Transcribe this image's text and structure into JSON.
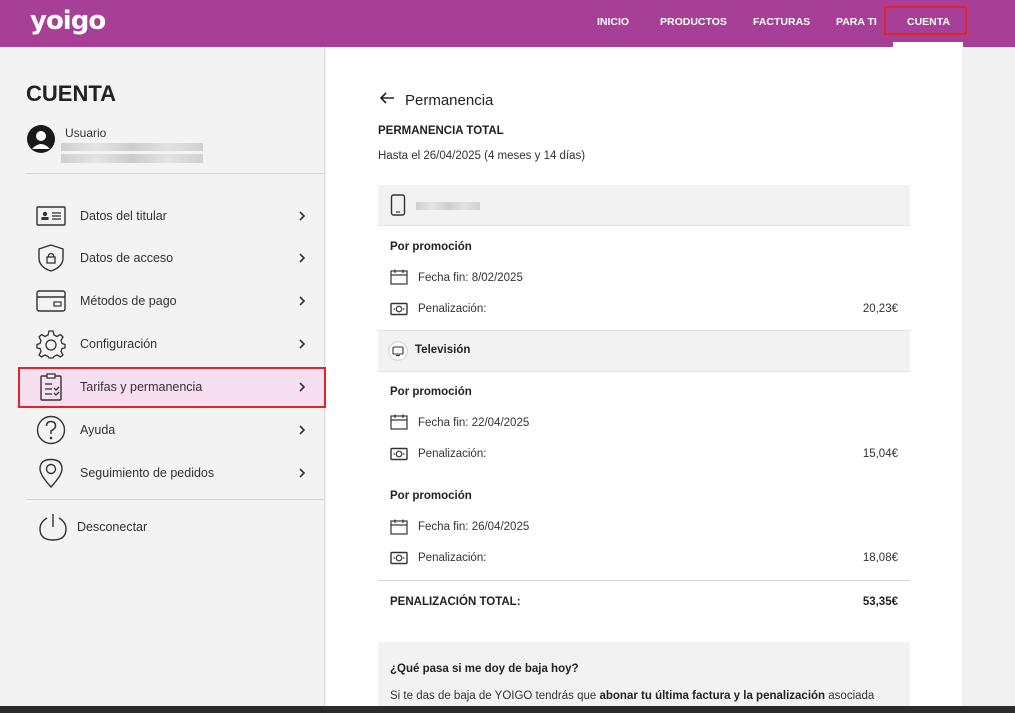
{
  "header": {
    "logo": "yoigo",
    "nav": [
      "INICIO",
      "PRODUCTOS",
      "FACTURAS",
      "PARA TI",
      "CUENTA"
    ],
    "active": "CUENTA"
  },
  "sidebar": {
    "title": "CUENTA",
    "user_label": "Usuario",
    "items": [
      {
        "label": "Datos del titular",
        "icon": "id-card-icon"
      },
      {
        "label": "Datos de acceso",
        "icon": "shield-lock-icon"
      },
      {
        "label": "Métodos de pago",
        "icon": "credit-card-icon"
      },
      {
        "label": "Configuración",
        "icon": "gear-icon"
      },
      {
        "label": "Tarifas y permanencia",
        "icon": "clipboard-icon"
      },
      {
        "label": "Ayuda",
        "icon": "help-icon"
      },
      {
        "label": "Seguimiento de pedidos",
        "icon": "location-pin-icon"
      }
    ],
    "logout": "Desconectar"
  },
  "main": {
    "title": "Permanencia",
    "total_heading": "PERMANENCIA TOTAL",
    "total_until": "Hasta el 26/04/2025 (4 meses y 14 días)",
    "tv_label": "Televisión",
    "promos": [
      {
        "title": "Por promoción",
        "fecha": "Fecha fin: 8/02/2025",
        "pen_label": "Penalización:",
        "pen_value": "20,23€"
      },
      {
        "title": "Por promoción",
        "fecha": "Fecha fin: 22/04/2025",
        "pen_label": "Penalización:",
        "pen_value": "15,04€"
      },
      {
        "title": "Por promoción",
        "fecha": "Fecha fin: 26/04/2025",
        "pen_label": "Penalización:",
        "pen_value": "18,08€"
      }
    ],
    "total_label": "PENALIZACIÓN TOTAL:",
    "total_value": "53,35€",
    "info_title": "¿Qué pasa si me doy de baja hoy?",
    "info_text_1": "Si te das de baja de YOIGO tendrás que ",
    "info_text_bold": "abonar tu última factura y la penalización",
    "info_text_2": " asociada"
  },
  "colors": {
    "brand": "#a83f97",
    "highlight": "#e2232a",
    "active_bg": "#f6dff0"
  }
}
